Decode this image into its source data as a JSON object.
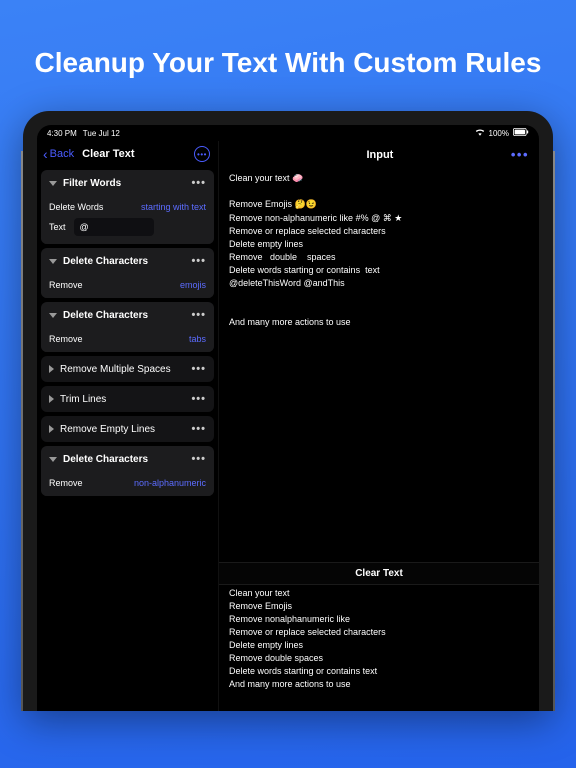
{
  "tagline": "Cleanup Your Text With Custom Rules",
  "status": {
    "time": "4:30 PM",
    "date": "Tue Jul 12",
    "battery": "100%"
  },
  "nav": {
    "back": "Back",
    "title": "Clear Text"
  },
  "rules": [
    {
      "title": "Filter Words",
      "expanded": true,
      "rows": [
        {
          "label": "Delete Words",
          "type": "link",
          "value": "starting with text"
        },
        {
          "label": "Text",
          "type": "input",
          "value": "@"
        }
      ]
    },
    {
      "title": "Delete Characters",
      "expanded": true,
      "rows": [
        {
          "label": "Remove",
          "type": "link",
          "value": "emojis"
        }
      ]
    },
    {
      "title": "Delete Characters",
      "expanded": true,
      "rows": [
        {
          "label": "Remove",
          "type": "link",
          "value": "tabs"
        }
      ]
    },
    {
      "title": "Remove Multiple Spaces",
      "expanded": false,
      "secondary": true
    },
    {
      "title": "Trim Lines",
      "expanded": false,
      "secondary": true
    },
    {
      "title": "Remove Empty Lines",
      "expanded": false,
      "secondary": true
    },
    {
      "title": "Delete Characters",
      "expanded": true,
      "rows": [
        {
          "label": "Remove",
          "type": "link",
          "value": "non-alphanumeric"
        }
      ]
    }
  ],
  "main": {
    "input_title": "Input",
    "input_text": "Clean your text 🧼\n\nRemove Emojis 🤔😉\nRemove non-alphanumeric like #% @ ⌘ ★\nRemove or replace selected characters\nDelete empty lines\nRemove   double    spaces\nDelete words starting or contains  text\n@deleteThisWord @andThis\n\n\nAnd many more actions to use",
    "clear_title": "Clear Text",
    "output_text": "Clean your text\nRemove Emojis\nRemove nonalphanumeric like\nRemove or replace selected characters\nDelete empty lines\nRemove double spaces\nDelete words starting or contains text\nAnd many more actions to use"
  }
}
